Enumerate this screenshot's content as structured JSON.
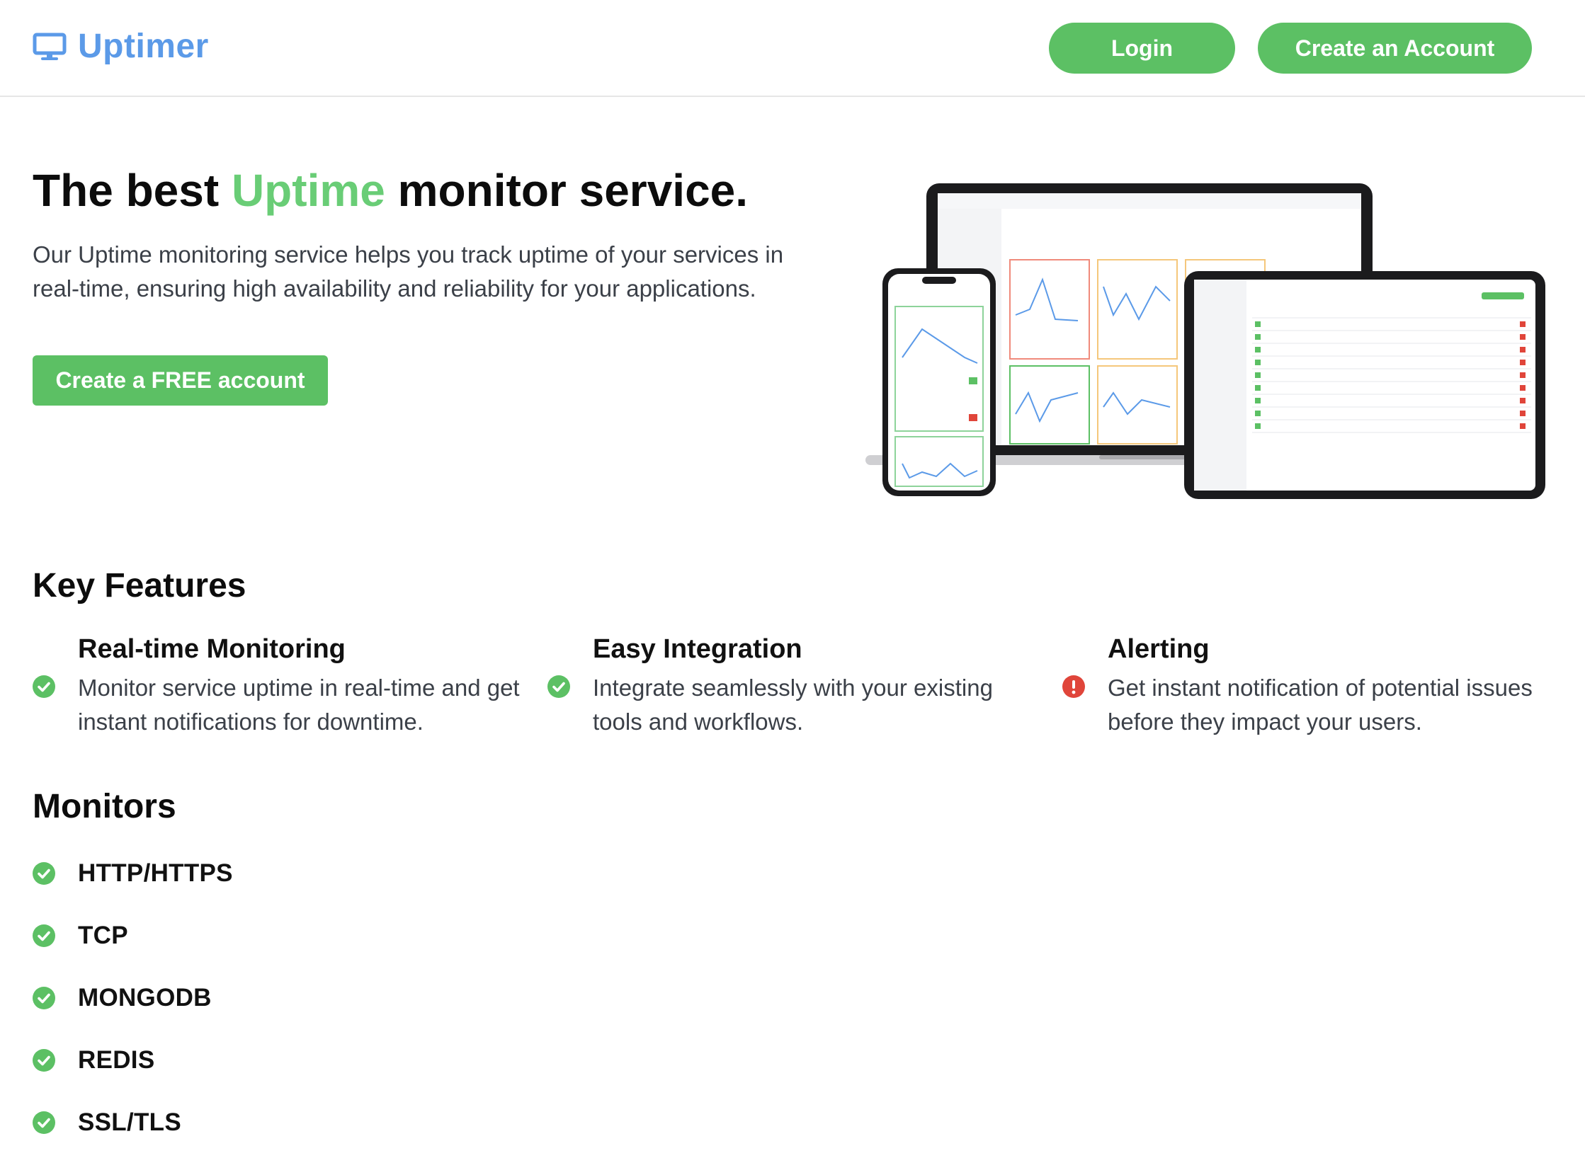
{
  "header": {
    "brand": "Uptimer",
    "login_label": "Login",
    "create_account_label": "Create an Account"
  },
  "hero": {
    "title_before": "The best ",
    "title_accent": "Uptime",
    "title_after": " monitor service.",
    "description": "Our Uptime monitoring service helps you track uptime of your services in real-time, ensuring high availability and reliability for your applications.",
    "cta_label": "Create a FREE account"
  },
  "features": {
    "title": "Key Features",
    "items": [
      {
        "title": "Real-time Monitoring",
        "description": "Monitor service uptime in real-time and get instant notifications for downtime.",
        "icon": "check-circle-icon",
        "color": "#5cc064"
      },
      {
        "title": "Easy Integration",
        "description": "Integrate seamlessly with your existing tools and workflows.",
        "icon": "check-circle-icon",
        "color": "#5cc064"
      },
      {
        "title": "Alerting",
        "description": "Get instant notification of potential issues before they impact your users.",
        "icon": "alert-circle-icon",
        "color": "#e0453a"
      }
    ]
  },
  "monitors": {
    "title": "Monitors",
    "items": [
      "HTTP/HTTPS",
      "TCP",
      "MONGODB",
      "REDIS",
      "SSL/TLS"
    ]
  },
  "colors": {
    "brand_blue": "#5b9ae8",
    "accent_green": "#69cd76",
    "button_green": "#5cc064",
    "alert_red": "#e0453a"
  }
}
